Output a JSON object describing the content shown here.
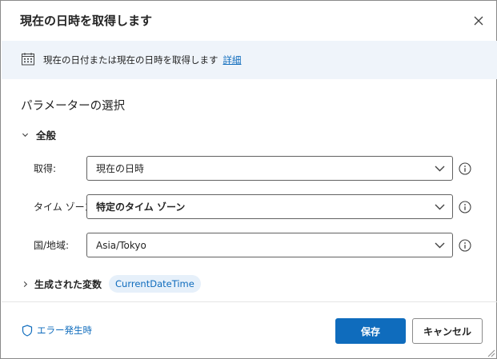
{
  "dialog": {
    "title": "現在の日時を取得します"
  },
  "info_bar": {
    "text": "現在の日付または現在の日時を取得します",
    "link": "詳細"
  },
  "section": {
    "title": "パラメーターの選択"
  },
  "general_group": {
    "label": "全般",
    "fields": [
      {
        "label": "取得:",
        "value": "現在の日時",
        "bold": false
      },
      {
        "label": "タイム ゾーン:",
        "value": "特定のタイム ゾーン",
        "bold": true
      },
      {
        "label": "国/地域:",
        "value": "Asia/Tokyo",
        "bold": false
      }
    ]
  },
  "variables": {
    "label": "生成された変数",
    "chip": "CurrentDateTime"
  },
  "footer": {
    "on_error": "エラー発生時",
    "save": "保存",
    "cancel": "キャンセル"
  },
  "colors": {
    "accent": "#0f6cbd",
    "info_bar_bg": "#eff4fa",
    "chip_bg": "#e6f0fa"
  },
  "icons": [
    "close-icon",
    "calendar-icon",
    "chevron-down-icon",
    "info-circle-icon",
    "chevron-right-icon",
    "shield-icon"
  ]
}
